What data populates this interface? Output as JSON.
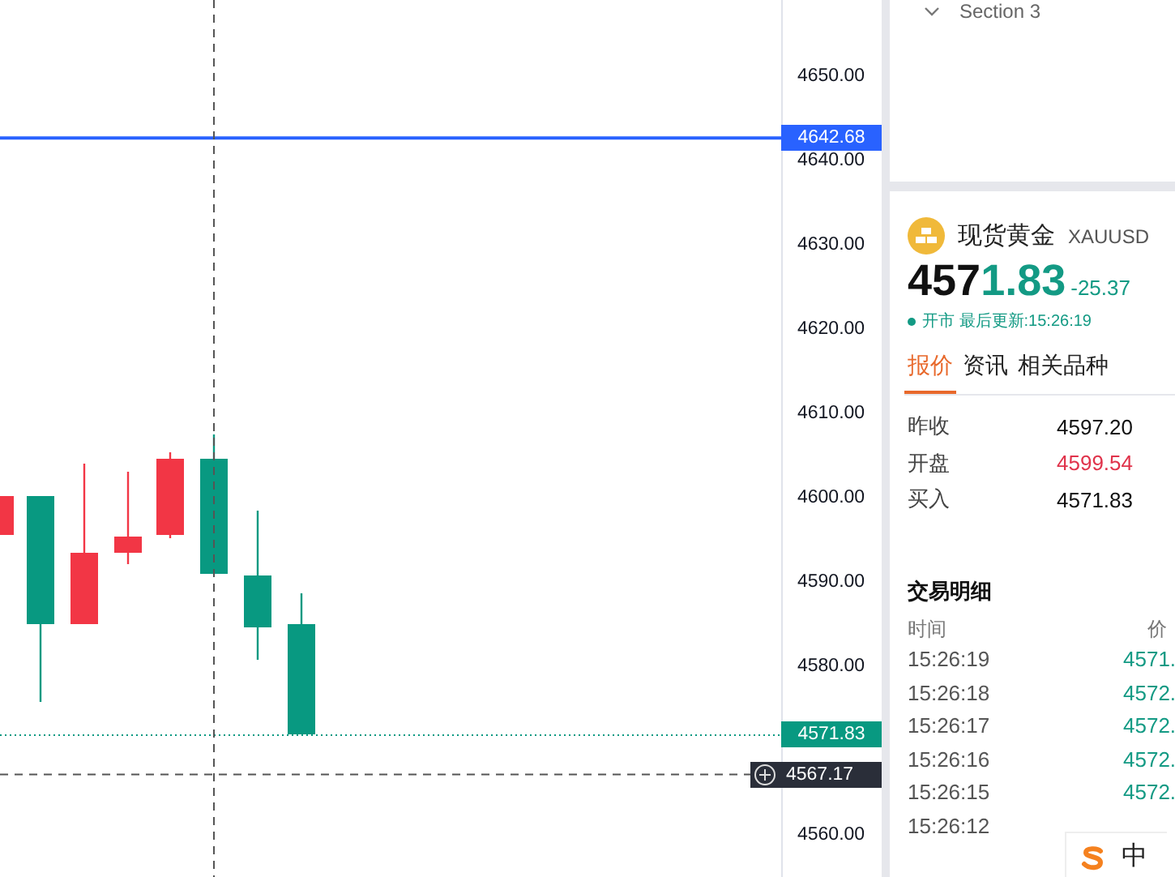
{
  "price_axis": {
    "labels": [
      "4650.00",
      "4640.00",
      "4630.00",
      "4620.00",
      "4610.00",
      "4600.00",
      "4590.00",
      "4580.00",
      "4560.00"
    ]
  },
  "price_tags": [
    {
      "kind": "alert",
      "value": "4642.68"
    },
    {
      "kind": "last",
      "value": "4571.83"
    },
    {
      "kind": "crosshair",
      "value": "4567.17"
    }
  ],
  "section": {
    "title": "Section 3",
    "expanded": true
  },
  "quote": {
    "name": "现货黄金",
    "symbol": "XAUUSD",
    "price_main": "457",
    "price_accent": "1.83",
    "change": "-25.37",
    "status": "开市 最后更新:15:26:19",
    "tabs": [
      {
        "label": "报价",
        "selected": true
      },
      {
        "label": "资讯",
        "selected": false
      },
      {
        "label": "相关品种",
        "selected": false
      }
    ],
    "stats": [
      {
        "label": "昨收",
        "value": "4597.20",
        "up": false
      },
      {
        "label": "开盘",
        "value": "4599.54",
        "up": true
      },
      {
        "label": "买入",
        "value": "4571.83",
        "up": false
      }
    ]
  },
  "trades": {
    "title": "交易明细",
    "columns": [
      "时间",
      "价"
    ],
    "rows": [
      {
        "time": "15:26:19",
        "price": "4571."
      },
      {
        "time": "15:26:18",
        "price": "4572."
      },
      {
        "time": "15:26:17",
        "price": "4572."
      },
      {
        "time": "15:26:16",
        "price": "4572."
      },
      {
        "time": "15:26:15",
        "price": "4572."
      },
      {
        "time": "15:26:12"
      }
    ]
  },
  "ime_toolbar": {
    "mode": "中"
  }
}
